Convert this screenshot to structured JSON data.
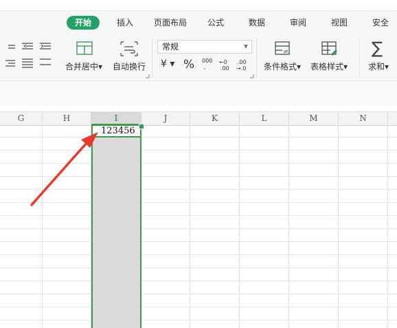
{
  "tabs": {
    "home": "开始",
    "insert": "插入",
    "page_layout": "页面布局",
    "formulas": "公式",
    "data": "数据",
    "review": "审阅",
    "view": "视图",
    "security": "安全"
  },
  "toolbar": {
    "merge_center": "合并居中",
    "auto_wrap": "自动换行",
    "number_format": "常规",
    "currency_symbol": "¥",
    "percent_symbol": "%",
    "thousands_symbol": "000",
    "conditional_format": "条件格式",
    "table_style": "表格样式",
    "sum": "求和"
  },
  "columns": [
    "G",
    "H",
    "I",
    "J",
    "K",
    "L",
    "M",
    "N"
  ],
  "selected_column": "I",
  "cell": {
    "value": "123456"
  },
  "colors": {
    "accent": "#21a366",
    "selection_border": "#3a9a4e",
    "arrow": "#e8392f"
  }
}
